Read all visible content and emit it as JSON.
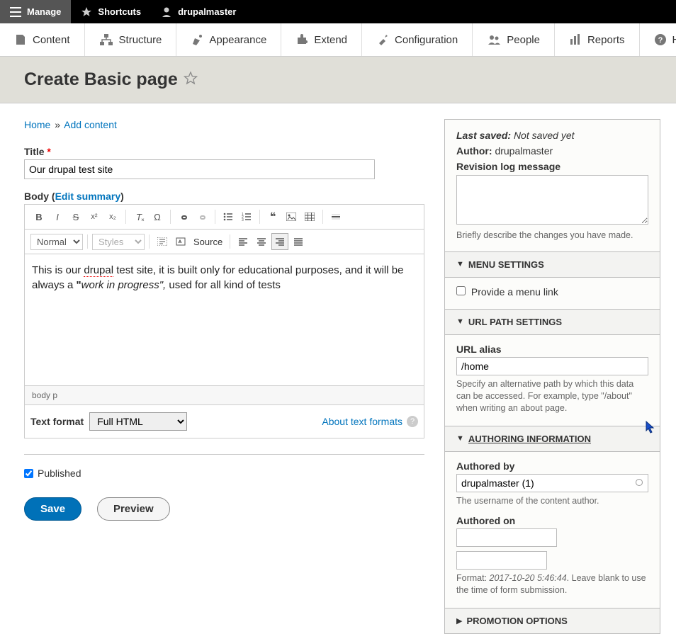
{
  "topbar": {
    "manage": "Manage",
    "shortcuts": "Shortcuts",
    "user": "drupalmaster"
  },
  "menubar": {
    "content": "Content",
    "structure": "Structure",
    "appearance": "Appearance",
    "extend": "Extend",
    "configuration": "Configuration",
    "people": "People",
    "reports": "Reports",
    "help": "Help"
  },
  "page_title": "Create Basic page",
  "breadcrumb": {
    "home": "Home",
    "add": "Add content",
    "sep": "»"
  },
  "title_field": {
    "label": "Title",
    "value": "Our drupal test site"
  },
  "body_field": {
    "label_prefix": "Body (",
    "label_link": "Edit summary",
    "label_suffix": ")",
    "format_dropdown": "Normal",
    "styles_dropdown": "Styles",
    "source_label": "Source",
    "content_prefix": "This is our ",
    "content_dotted": "drupal",
    "content_mid": " test site, it is built only for educational purposes, and it will be always a ",
    "content_bold": "\"",
    "content_italic": "work in progress\",",
    "content_suffix": " used for all kind of tests",
    "elements_path": "body  p"
  },
  "text_format": {
    "label": "Text format",
    "value": "Full HTML",
    "about": "About text formats"
  },
  "published": {
    "label": "Published",
    "checked": true
  },
  "buttons": {
    "save": "Save",
    "preview": "Preview"
  },
  "side": {
    "last_saved_label": "Last saved:",
    "last_saved_value": "Not saved yet",
    "author_label": "Author:",
    "author_value": "drupalmaster",
    "revision_log_label": "Revision log message",
    "revision_log_desc": "Briefly describe the changes you have made.",
    "menu_settings": "MENU SETTINGS",
    "menu_link": "Provide a menu link",
    "url_settings": "URL PATH SETTINGS",
    "url_alias_label": "URL alias",
    "url_alias_value": "/home",
    "url_alias_desc": "Specify an alternative path by which this data can be accessed. For example, type \"/about\" when writing an about page.",
    "authoring": "AUTHORING INFORMATION",
    "authored_by_label": "Authored by",
    "authored_by_value": "drupalmaster (1)",
    "authored_by_desc": "The username of the content author.",
    "authored_on_label": "Authored on",
    "authored_on_desc_prefix": "Format: ",
    "authored_on_desc_date": "2017-10-20   5:46:44",
    "authored_on_desc_suffix": ". Leave blank to use the time of form submission.",
    "promotion": "PROMOTION OPTIONS"
  }
}
